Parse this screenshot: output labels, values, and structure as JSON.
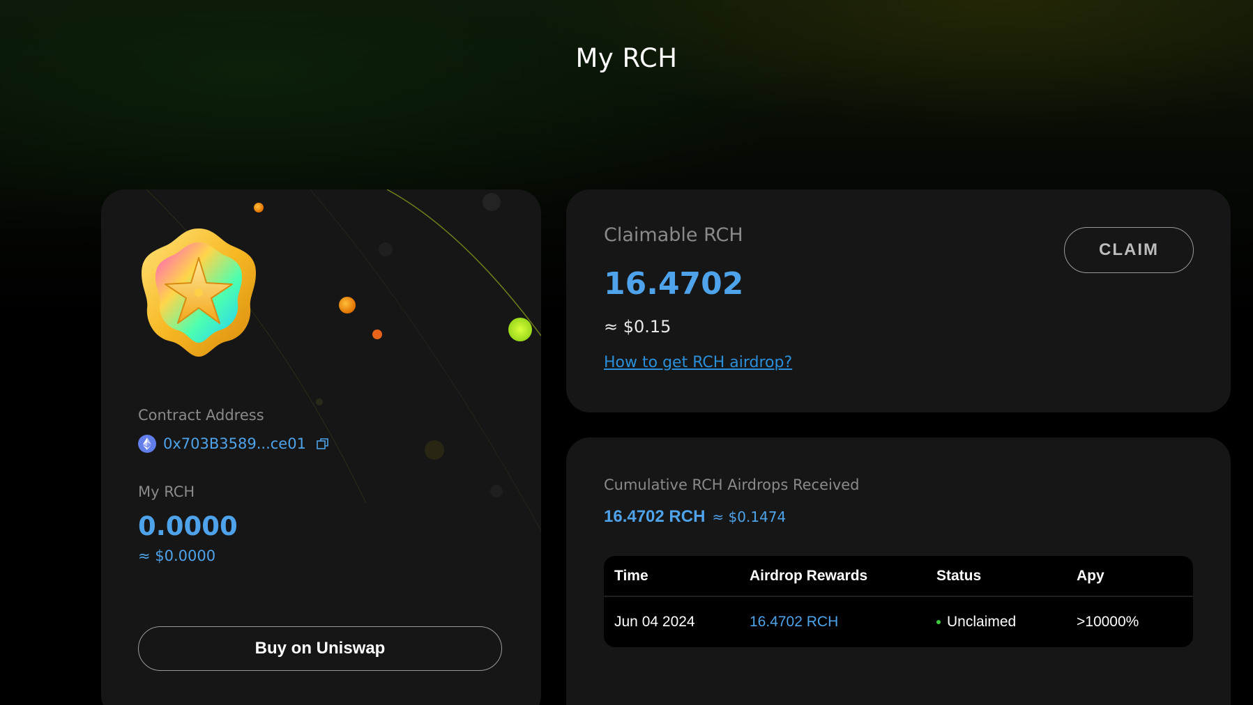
{
  "page": {
    "title": "My RCH"
  },
  "token_card": {
    "contract_label": "Contract Address",
    "contract_address": "0x703B3589...ce01",
    "balance_label": "My RCH",
    "balance": "0.0000",
    "balance_usd": "≈ $0.0000",
    "buy_button_label": "Buy on Uniswap"
  },
  "claim_card": {
    "label": "Claimable RCH",
    "amount": "16.4702",
    "usd": "≈ $0.15",
    "link_text": "How to get RCH airdrop?",
    "claim_button_label": "CLAIM"
  },
  "history_card": {
    "label": "Cumulative RCH Airdrops Received",
    "total": "16.4702 RCH",
    "total_usd": "≈ $0.1474",
    "columns": [
      "Time",
      "Airdrop Rewards",
      "Status",
      "Apy"
    ],
    "rows": [
      {
        "time": "Jun 04 2024",
        "reward": "16.4702 RCH",
        "status": "Unclaimed",
        "apy": ">10000%"
      }
    ]
  },
  "colors": {
    "accent_blue": "#4ea3ea",
    "link_blue": "#2b8fd9",
    "card_bg": "#161616",
    "status_green": "#3ecb3e"
  }
}
